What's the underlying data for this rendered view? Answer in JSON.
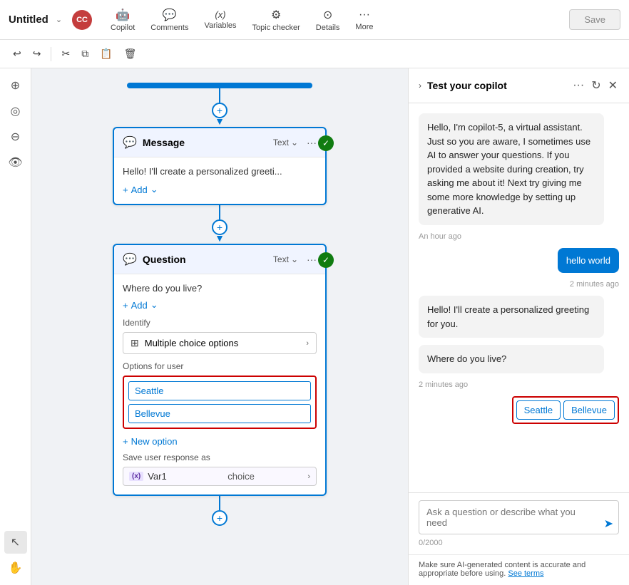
{
  "toolbar": {
    "title": "Untitled",
    "chevron": "⌄",
    "avatar": "CC",
    "items": [
      {
        "label": "Copilot",
        "icon": "🤖"
      },
      {
        "label": "Comments",
        "icon": "💬"
      },
      {
        "label": "Variables",
        "icon": "(x)"
      },
      {
        "label": "Topic checker",
        "icon": "🔍"
      },
      {
        "label": "Details",
        "icon": "⊙"
      },
      {
        "label": "More",
        "icon": "···"
      }
    ],
    "save_label": "Save"
  },
  "secondary_toolbar": {
    "undo": "↩",
    "redo": "↪",
    "cut": "✂",
    "copy": "⧉",
    "paste": "📋",
    "delete": "🗑"
  },
  "message_node": {
    "title": "Message",
    "type": "Text",
    "body": "Hello! I'll create a personalized greeti...",
    "add_label": "Add"
  },
  "question_node": {
    "title": "Question",
    "type": "Text",
    "question": "Where do you live?",
    "add_label": "Add",
    "identify_label": "Identify",
    "identify_option": "Multiple choice options",
    "options_header": "Options for user",
    "options": [
      "Seattle",
      "Bellevue"
    ],
    "new_option_label": "New option",
    "save_response_label": "Save user response as",
    "var_badge": "(x)",
    "var_name": "Var1",
    "var_val": "choice"
  },
  "right_panel": {
    "title": "Test your copilot",
    "intro_message": "Hello, I'm copilot-5, a virtual assistant. Just so you are aware, I sometimes use AI to answer your questions. If you provided a website during creation, try asking me about it! Next try giving me some more knowledge by setting up generative AI.",
    "time_ago": "An hour ago",
    "user_message": "hello world",
    "user_time": "2 minutes ago",
    "bot_reply1": "Hello! I'll create a personalized greeting for you.",
    "bot_reply2": "Where do you live?",
    "bot_reply2_time": "2 minutes ago",
    "choice_seattle": "Seattle",
    "choice_bellevue": "Bellevue",
    "input_placeholder": "Ask a question or describe what you need",
    "char_count": "0/2000",
    "footer_text": "Make sure AI-generated content is accurate and appropriate before using.",
    "footer_link": "See terms"
  }
}
